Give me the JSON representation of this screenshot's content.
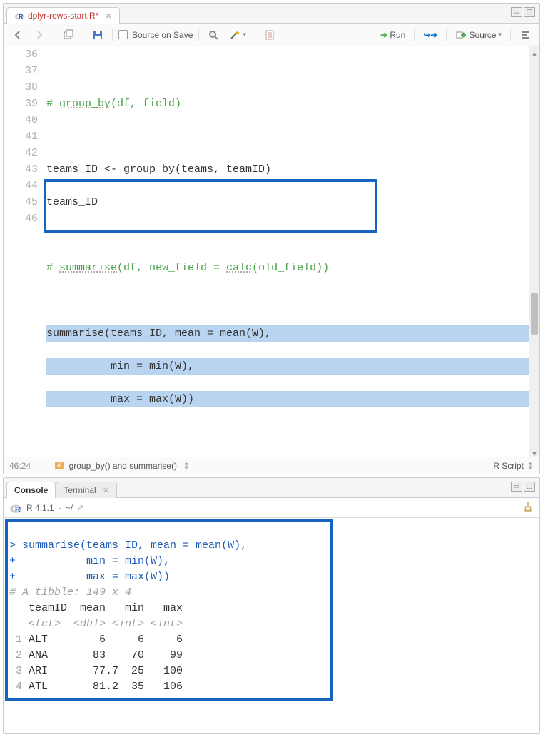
{
  "editor_pane": {
    "tab": {
      "filename": "dplyr-rows-start.R",
      "dirty_marker": "*"
    },
    "toolbar": {
      "source_on_save": "Source on Save",
      "run": "Run",
      "source_btn": "Source"
    },
    "lines": {
      "36": "",
      "37_pre": "# ",
      "37_fn": "group_by",
      "37_rest": "(df, field)",
      "38": "",
      "39": "teams_ID <- group_by(teams, teamID)",
      "40": "teams_ID",
      "41": "",
      "42_pre": "# ",
      "42_fn": "summarise",
      "42_mid": "(df, new_field = ",
      "42_calc": "calc",
      "42_end": "(old_field))",
      "43": "",
      "44": "summarise(teams_ID, mean = mean(W),",
      "45": "          min = min(W),",
      "46": "          max = max(W))"
    },
    "gutter": [
      "36",
      "37",
      "38",
      "39",
      "40",
      "41",
      "42",
      "43",
      "44",
      "45",
      "46"
    ],
    "status": {
      "position": "46:24",
      "scope": "group_by() and summarise()",
      "filetype": "R Script"
    }
  },
  "console_pane": {
    "tabs": {
      "console": "Console",
      "terminal": "Terminal"
    },
    "header": {
      "version": "R 4.1.1",
      "path": "~/"
    },
    "output": {
      "l1_prompt": ">",
      "l1": " summarise(teams_ID, mean = mean(W),",
      "l2_prompt": "+",
      "l2": "           min = min(W),",
      "l3_prompt": "+",
      "l3": "           max = max(W))",
      "tibble_header": "# A tibble: 149 x 4",
      "col_header": "   teamID  mean   min   max",
      "type_row": "   <fct>  <dbl> <int> <int>",
      "rows": [
        {
          "n": "1",
          "team": "ALT",
          "mean": "6",
          "min": "6",
          "max": "6"
        },
        {
          "n": "2",
          "team": "ANA",
          "mean": "83",
          "min": "70",
          "max": "99"
        },
        {
          "n": "3",
          "team": "ARI",
          "mean": "77.7",
          "min": "25",
          "max": "100"
        },
        {
          "n": "4",
          "team": "ATL",
          "mean": "81.2",
          "min": "35",
          "max": "106"
        }
      ]
    }
  },
  "chart_data": {
    "type": "table",
    "title": "A tibble: 149 x 4",
    "columns": [
      "teamID",
      "mean",
      "min",
      "max"
    ],
    "column_types": [
      "<fct>",
      "<dbl>",
      "<int>",
      "<int>"
    ],
    "rows": [
      [
        "ALT",
        6,
        6,
        6
      ],
      [
        "ANA",
        83,
        70,
        99
      ],
      [
        "ARI",
        77.7,
        25,
        100
      ],
      [
        "ATL",
        81.2,
        35,
        106
      ]
    ]
  }
}
